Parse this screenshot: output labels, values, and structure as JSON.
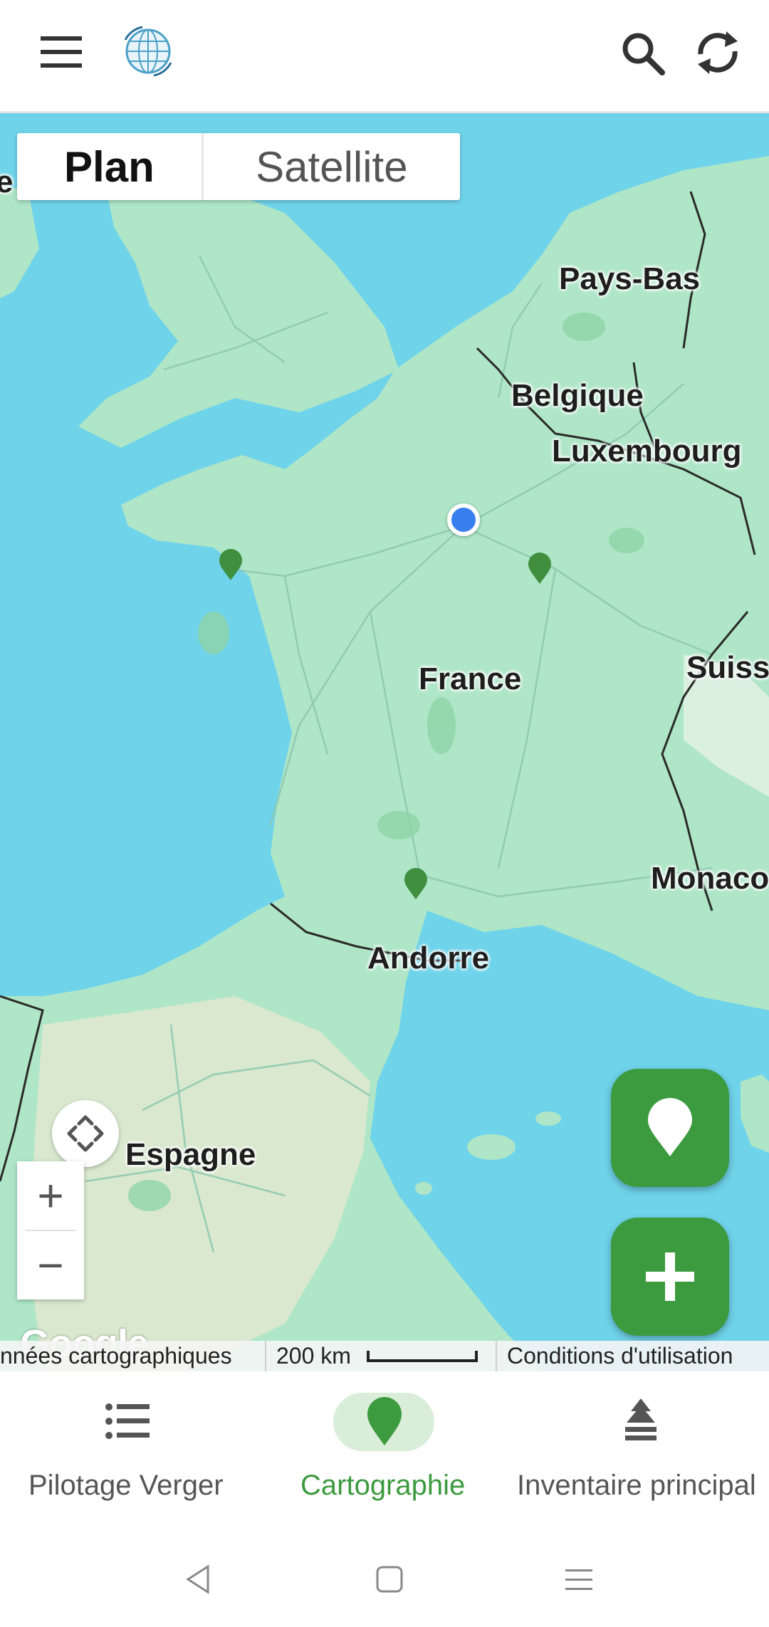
{
  "map": {
    "view_toggle": {
      "plan": "Plan",
      "satellite": "Satellite",
      "selected": "Plan"
    },
    "labels": {
      "netherlands": "Pays-Bas",
      "belgium": "Belgique",
      "luxembourg": "Luxembourg",
      "france": "France",
      "switzerland": "Suiss",
      "monaco": "Monaco",
      "andorra": "Andorre",
      "spain": "Espagne",
      "left_edge": "e"
    },
    "zoom": {
      "in": "+",
      "out": "−"
    },
    "google_logo": "Google",
    "attribution": {
      "map_data": "nnées cartographiques",
      "scale": "200 km",
      "terms": "Conditions d'utilisation"
    },
    "colors": {
      "water": "#6fd3ea",
      "land": "#aee6c7",
      "pin": "#3f8f3f",
      "user_location": "#3a7ff0"
    }
  },
  "fabs": {
    "locate_icon": "map-pin-icon",
    "add_icon": "plus-icon",
    "color": "#3c9a3f"
  },
  "bottom_nav": {
    "items": [
      {
        "label": "Pilotage Verger",
        "icon": "list-icon"
      },
      {
        "label": "Cartographie",
        "icon": "map-pin-icon",
        "active": true
      },
      {
        "label": "Inventaire principal",
        "icon": "tree-stack-icon"
      }
    ],
    "active_color": "#3c9a3f"
  }
}
